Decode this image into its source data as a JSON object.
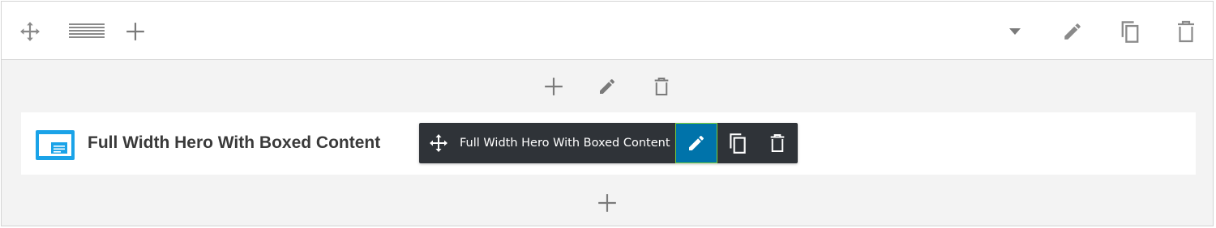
{
  "row": {
    "icons": [
      "move-icon",
      "row-layout-icon",
      "plus-icon",
      "caret-down-icon",
      "pencil-icon",
      "copy-icon",
      "trash-icon"
    ]
  },
  "column": {
    "icons": [
      "plus-icon",
      "pencil-icon",
      "trash-icon"
    ]
  },
  "module": {
    "title": "Full Width Hero With Boxed Content",
    "icon": "module-layout-icon",
    "icon_color": "#1aa3e8"
  },
  "toolbar": {
    "label": "Full Width Hero With Boxed Content",
    "icons": [
      "move-icon",
      "pencil-icon",
      "copy-icon",
      "trash-icon"
    ],
    "background": "#2f3338",
    "edit_active_color": "#0073aa",
    "edit_border_color": "#7ad03a"
  },
  "bottom": {
    "icons": [
      "plus-icon"
    ]
  }
}
